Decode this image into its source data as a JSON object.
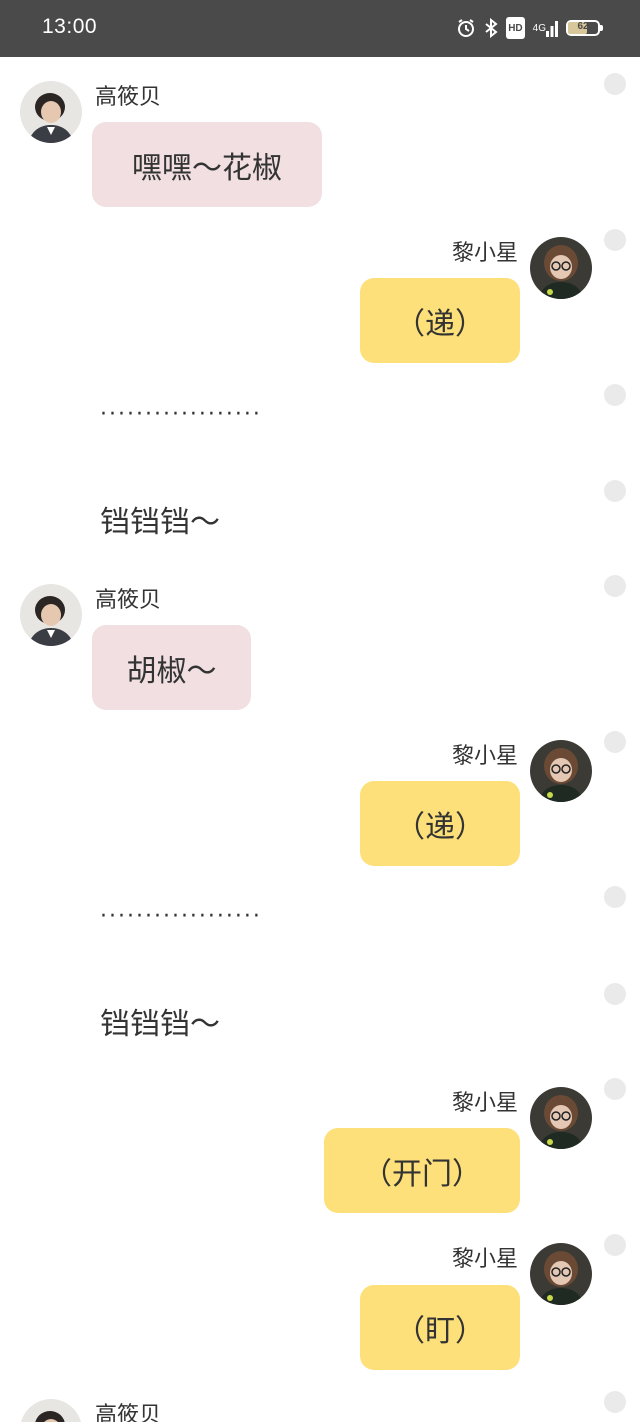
{
  "status_bar": {
    "time": "13:00",
    "icons": [
      "alarm-icon",
      "bluetooth-icon",
      "hd-icon",
      "signal-4g-icon",
      "battery-icon"
    ],
    "hd_label": "HD",
    "network_label": "4G",
    "battery_level": "62"
  },
  "colors": {
    "left_bubble": "#f2dfe1",
    "right_bubble": "#fde07a",
    "status_bar": "#4a4a4a"
  },
  "messages": [
    {
      "sender": "高筱贝",
      "side": "left",
      "text": "嘿嘿～花椒"
    },
    {
      "sender": "黎小星",
      "side": "right",
      "text": "（递）"
    },
    {
      "type": "narration",
      "text": "··················"
    },
    {
      "type": "narration",
      "text": "铛铛铛～"
    },
    {
      "sender": "高筱贝",
      "side": "left",
      "text": "胡椒～"
    },
    {
      "sender": "黎小星",
      "side": "right",
      "text": "（递）"
    },
    {
      "type": "narration",
      "text": "··················"
    },
    {
      "type": "narration",
      "text": "铛铛铛～"
    },
    {
      "sender": "黎小星",
      "side": "right",
      "text": "（开门）"
    },
    {
      "sender": "黎小星",
      "side": "right",
      "text": "（盯）"
    },
    {
      "sender": "高筱贝",
      "side": "left",
      "text": ""
    }
  ]
}
